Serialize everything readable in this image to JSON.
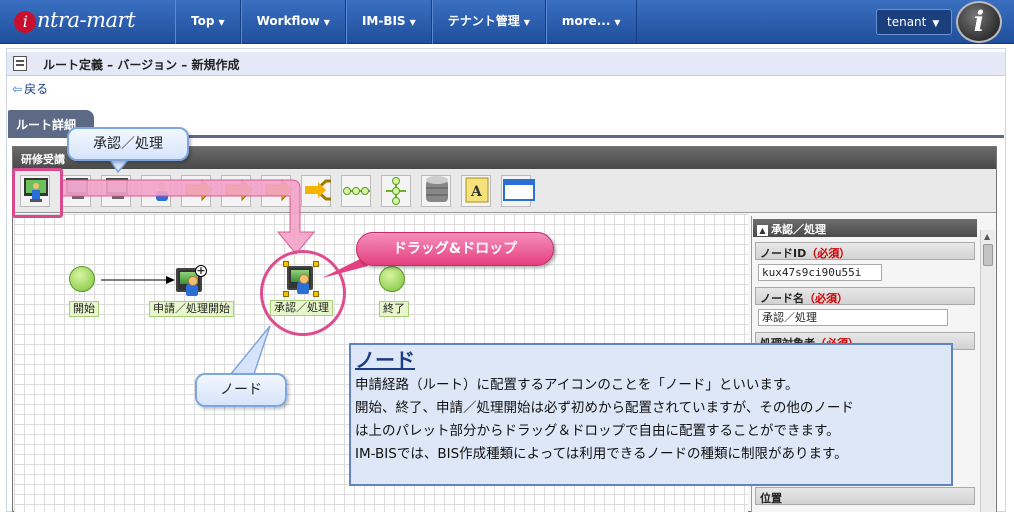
{
  "topbar": {
    "logo_text": "ntra-mart",
    "logo_badge": "i",
    "nav_items": [
      "Top",
      "Workflow",
      "IM-BIS",
      "テナント管理",
      "more..."
    ],
    "tenant_label": "tenant",
    "user_badge": "i"
  },
  "page": {
    "title": "ルート定義 – バージョン – 新規作成",
    "back_label": "戻る",
    "tab_label": "ルート詳細"
  },
  "designer": {
    "header": "研修受講"
  },
  "nodes": {
    "start": "開始",
    "apply": "申請／処理開始",
    "approve": "承認／処理",
    "end": "終了"
  },
  "properties": {
    "title": "承認／処理",
    "node_id_label": "ノードID",
    "node_id_required": "（必須）",
    "node_id_value": "kux47s9ci90u55i",
    "node_name_label": "ノード名",
    "node_name_required": "（必須）",
    "node_name_value": "承認／処理",
    "target_label": "処理対象者",
    "target_required": "（必須）",
    "position_label": "位置"
  },
  "callouts": {
    "palette_item": "承認／処理",
    "drag_drop": "ドラッグ&ドロップ",
    "node": "ノード"
  },
  "infobox": {
    "title": "ノード",
    "lines": [
      "申請経路（ルート）に配置するアイコンのことを「ノード」といいます。",
      "開始、終了、申請／処理開始は必ず初めから配置されていますが、その他のノード",
      "は上のパレット部分からドラッグ＆ドロップで自由に配置することができます。",
      "IM-BISでは、BIS作成種類によっては利用できるノードの種類に制限があります。"
    ]
  },
  "colors": {
    "accent_blue": "#2a5aa8",
    "callout_pink": "#e4407f",
    "required_red": "#d00000"
  }
}
